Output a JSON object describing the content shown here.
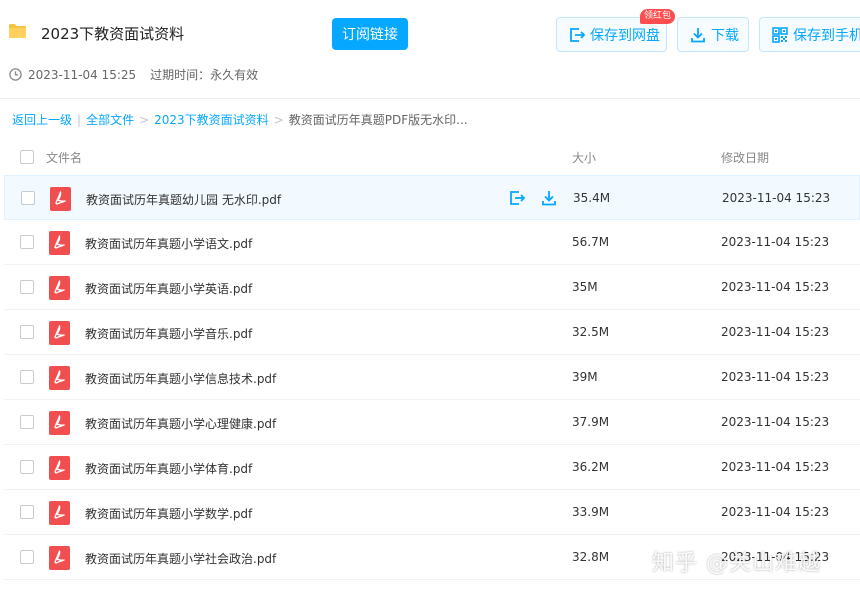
{
  "header": {
    "folder_name": "2023下教资面试资料",
    "subscribe_label": "订阅链接",
    "save_to_disk_label": "保存到网盘",
    "red_packet_badge": "领红包",
    "download_label": "下载",
    "save_to_phone_label": "保存到手机",
    "share_time": "2023-11-04 15:25",
    "expire_text": "过期时间：永久有效",
    "accent_color": "#06a7ff"
  },
  "breadcrumb": {
    "back": "返回上一级",
    "all_files": "全部文件",
    "folder": "2023下教资面试资料",
    "current": "教资面试历年真题PDF版无水印..."
  },
  "table": {
    "col_name": "文件名",
    "col_size": "大小",
    "col_date": "修改日期"
  },
  "files": [
    {
      "name": "教资面试历年真题幼儿园 无水印.pdf",
      "size": "35.4M",
      "date": "2023-11-04 15:23"
    },
    {
      "name": "教资面试历年真题小学语文.pdf",
      "size": "56.7M",
      "date": "2023-11-04 15:23"
    },
    {
      "name": "教资面试历年真题小学英语.pdf",
      "size": "35M",
      "date": "2023-11-04 15:23"
    },
    {
      "name": "教资面试历年真题小学音乐.pdf",
      "size": "32.5M",
      "date": "2023-11-04 15:23"
    },
    {
      "name": "教资面试历年真题小学信息技术.pdf",
      "size": "39M",
      "date": "2023-11-04 15:23"
    },
    {
      "name": "教资面试历年真题小学心理健康.pdf",
      "size": "37.9M",
      "date": "2023-11-04 15:23"
    },
    {
      "name": "教资面试历年真题小学体育.pdf",
      "size": "36.2M",
      "date": "2023-11-04 15:23"
    },
    {
      "name": "教资面试历年真题小学数学.pdf",
      "size": "33.9M",
      "date": "2023-11-04 15:23"
    },
    {
      "name": "教资面试历年真题小学社会政治.pdf",
      "size": "32.8M",
      "date": "2023-11-04 15:23"
    }
  ],
  "watermark": "知乎 @关山难越"
}
